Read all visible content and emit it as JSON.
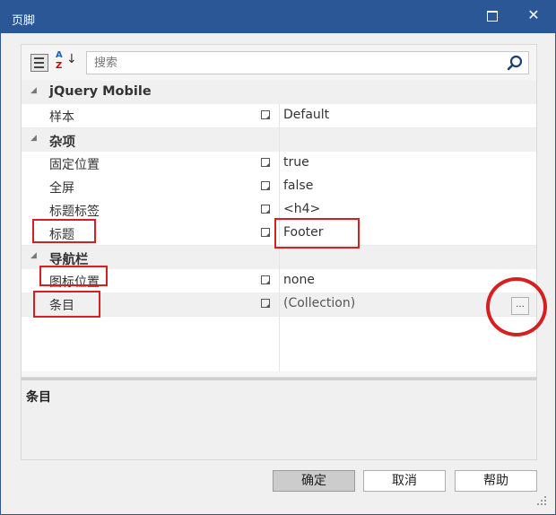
{
  "window": {
    "title": "页脚"
  },
  "search": {
    "placeholder": "搜索"
  },
  "grid": {
    "rows": [
      {
        "kind": "category",
        "label": "jQuery Mobile"
      },
      {
        "kind": "property",
        "name": "样本",
        "value": "Default"
      },
      {
        "kind": "category",
        "label": "杂项"
      },
      {
        "kind": "property",
        "name": "固定位置",
        "value": "true"
      },
      {
        "kind": "property",
        "name": "全屏",
        "value": "false"
      },
      {
        "kind": "property",
        "name": "标题标签",
        "value": "<h4>"
      },
      {
        "kind": "property",
        "name": "标题",
        "value": "Footer"
      },
      {
        "kind": "category",
        "label": "导航栏"
      },
      {
        "kind": "property",
        "name": "图标位置",
        "value": "none"
      },
      {
        "kind": "property",
        "name": "条目",
        "value": "(Collection)"
      }
    ],
    "ellipsis_label": "..."
  },
  "description": {
    "title": "条目"
  },
  "buttons": {
    "ok": "确定",
    "cancel": "取消",
    "help": "帮助"
  },
  "colors": {
    "titlebar": "#2b5797",
    "highlight": "#d61f1f"
  }
}
